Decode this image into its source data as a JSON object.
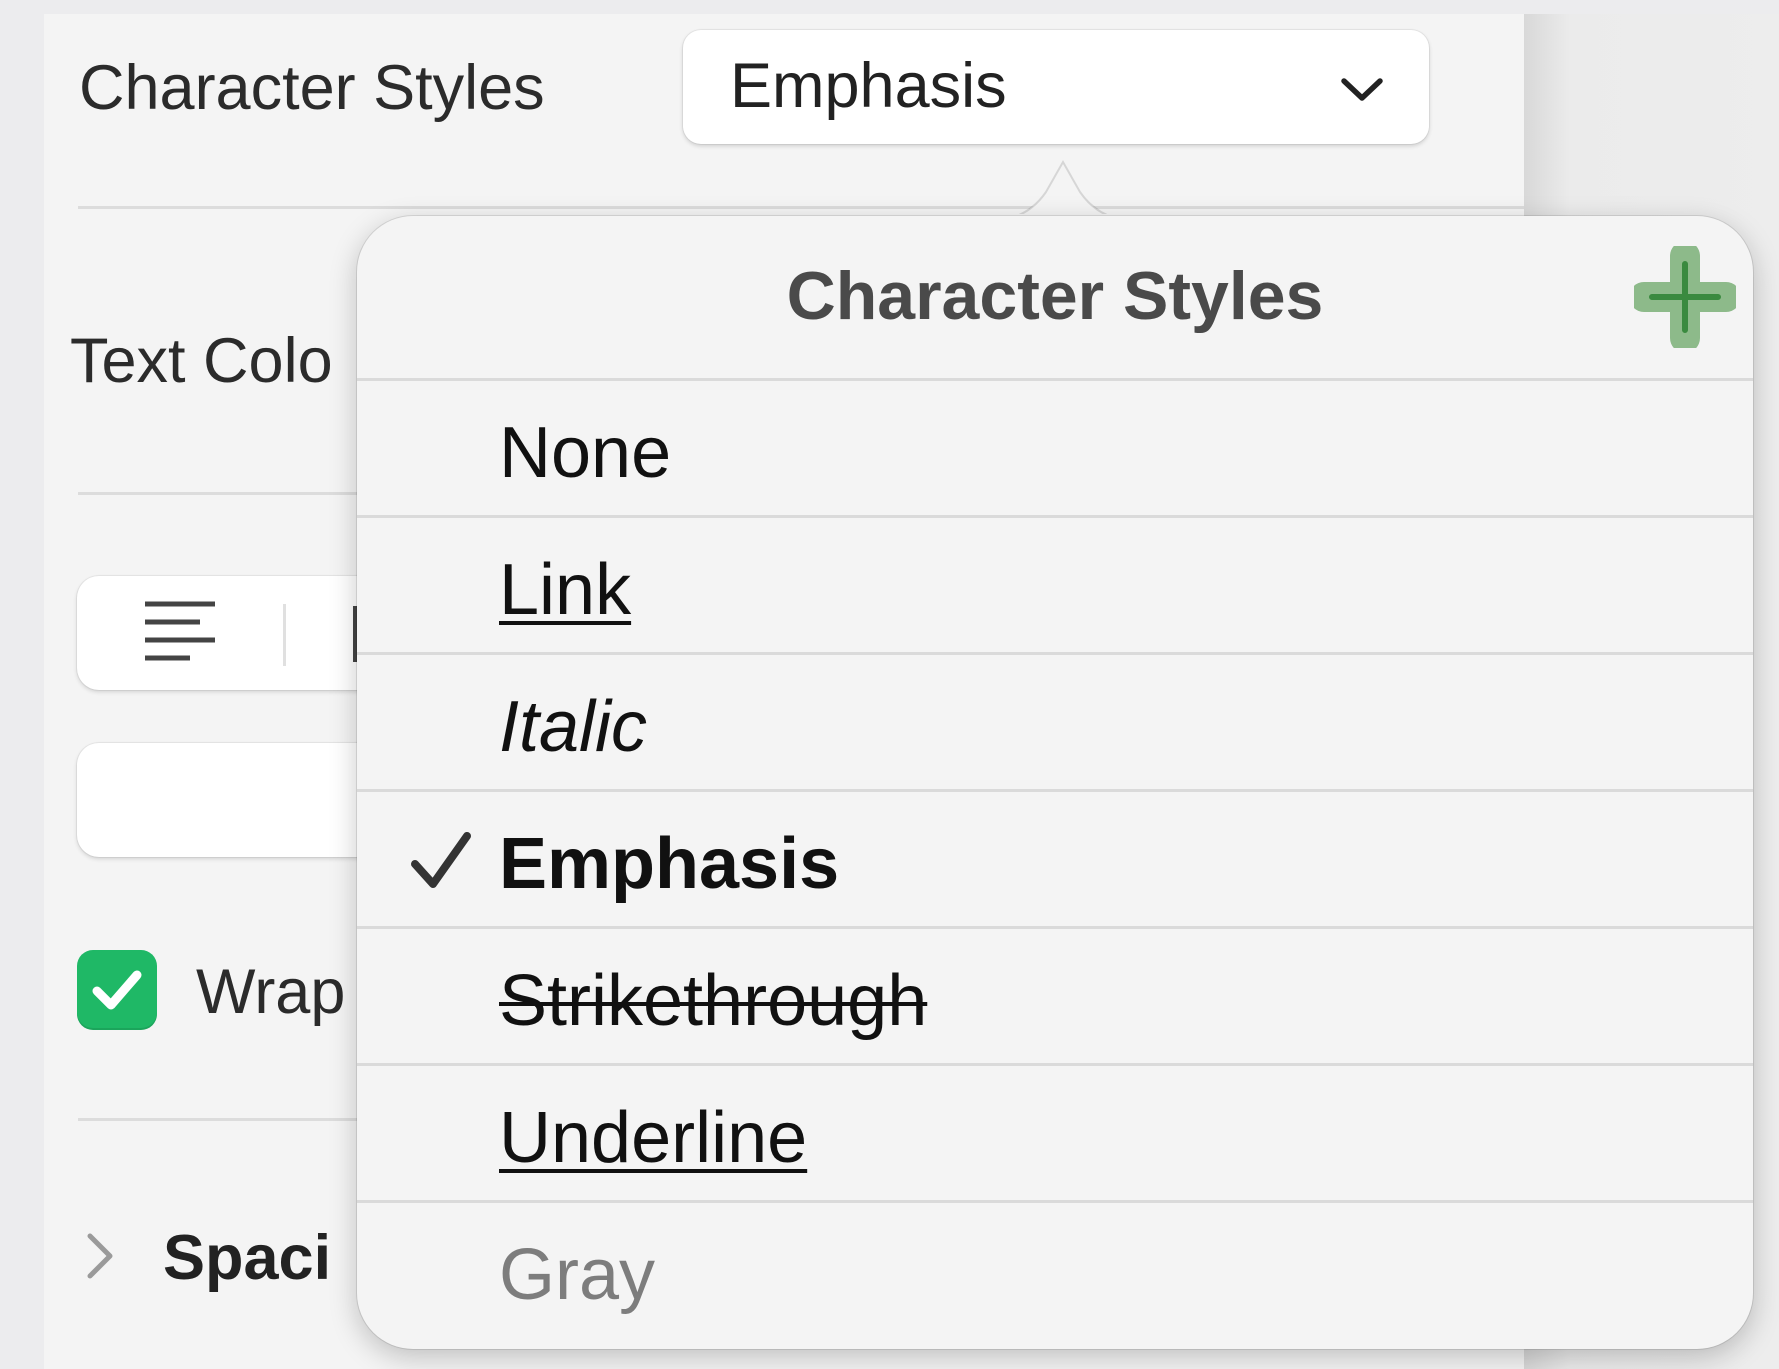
{
  "inspector": {
    "character_styles_label": "Character Styles",
    "character_styles_value": "Emphasis",
    "text_color_label": "Text Colo",
    "wrap_label": "Wrap",
    "wrap_checked": true,
    "spacing_label": "Spaci"
  },
  "popover": {
    "title": "Character Styles",
    "add_icon": "plus-icon",
    "selected": "Emphasis",
    "items": [
      {
        "label": "None",
        "style": "plain"
      },
      {
        "label": "Link",
        "style": "underline"
      },
      {
        "label": "Italic",
        "style": "italic"
      },
      {
        "label": "Emphasis",
        "style": "bold",
        "checked": true
      },
      {
        "label": "Strikethrough",
        "style": "strikethrough"
      },
      {
        "label": "Underline",
        "style": "underline"
      },
      {
        "label": "Gray",
        "style": "gray"
      }
    ]
  },
  "colors": {
    "accent_green": "#1fb866",
    "add_button_green": "#8dba8a",
    "panel_bg": "#f4f4f4"
  }
}
